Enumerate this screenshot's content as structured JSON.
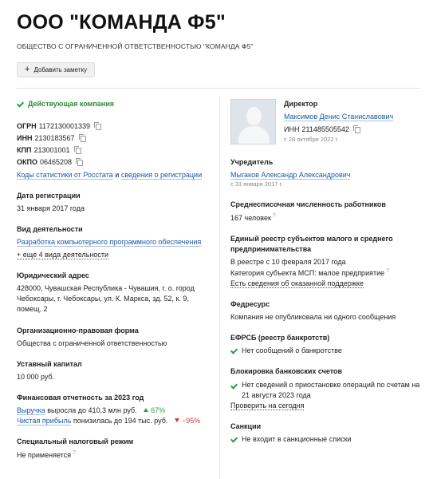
{
  "header": {
    "title": "ООО \"КОМАНДА Ф5\"",
    "full_name": "ОБЩЕСТВО С ОГРАНИЧЕННОЙ ОТВЕТСТВЕННОСТЬЮ \"КОМАНДА Ф5\"",
    "add_note_label": "Добавить заметку"
  },
  "left": {
    "status": "Действующая компания",
    "ogrn_label": "ОГРН",
    "ogrn": "1172130001339",
    "inn_label": "ИНН",
    "inn": "2130183567",
    "kpp_label": "КПП",
    "kpp": "213001001",
    "okpo_label": "ОКПО",
    "okpo": "06465208",
    "codes_link": "Коды статистики от Росстата",
    "codes_and": "и",
    "reg_info_link": "сведения о регистрации",
    "reg_date_label": "Дата регистрации",
    "reg_date": "31 января 2017 года",
    "activity_label": "Вид деятельности",
    "activity_link": "Разработка компьютерного программного обеспечения",
    "activity_more": "+ еще 4 вида деятельности",
    "address_label": "Юридический адрес",
    "address": "428000, Чувашская Республика - Чувашия, г. о. город Чебоксары, г. Чебоксары, ул. К. Маркса, зд. 52, к. 9, помещ. 2",
    "legal_form_label": "Организационно-правовая форма",
    "legal_form": "Общества с ограниченной ответственностью",
    "capital_label": "Уставный капитал",
    "capital": "10 000 руб.",
    "finance_label": "Финансовая отчетность за 2023 год",
    "revenue_link": "Выручка",
    "revenue_text": "выросла до 410,3 млн руб.",
    "revenue_change": "67%",
    "profit_link": "Чистая прибыль",
    "profit_text": "понизилась до 194 тыс. руб.",
    "profit_change": "−95%",
    "tax_label": "Специальный налоговый режим",
    "tax": "Не применяется"
  },
  "right": {
    "director_label": "Директор",
    "director_name": "Максимов Денис Станиславович",
    "director_inn_label": "ИНН",
    "director_inn": "211485505542",
    "director_since": "с 28 октября 2022 г.",
    "founder_label": "Учредитель",
    "founder_name": "Мыгаков Александр Александрович",
    "founder_since": "с 31 января 2017 г.",
    "staff_label": "Среднесписочная численность работников",
    "staff": "167 человек",
    "msp_label": "Единый реестр субъектов малого и среднего предпринимательства",
    "msp_since": "В реестре с 10 февраля 2017 года",
    "msp_category": "Категория субъекта МСП: малое предприятие",
    "msp_support_link": "Есть сведения об оказанной поддержке",
    "fedresurs_label": "Федресурс",
    "fedresurs": "Компания не опубликовала ни одного сообщения",
    "efrsb_label": "ЕФРСБ (реестр банкротств)",
    "efrsb": "Нет сообщений о банкротстве",
    "blocks_label": "Блокировка банковских счетов",
    "blocks": "Нет сведений о приостановке операций по счетам на 21 августа 2023 года",
    "blocks_check_link": "Проверить на сегодня",
    "sanctions_label": "Санкции",
    "sanctions": "Не входит в санкционные списки"
  },
  "colors": {
    "ok": "#2e9b45",
    "link": "#1a5aa6",
    "down": "#d23a3a"
  },
  "icons": [
    "check-icon",
    "copy-icon",
    "plus-icon",
    "question-icon",
    "arrow-up-icon",
    "arrow-down-icon",
    "avatar-placeholder"
  ]
}
